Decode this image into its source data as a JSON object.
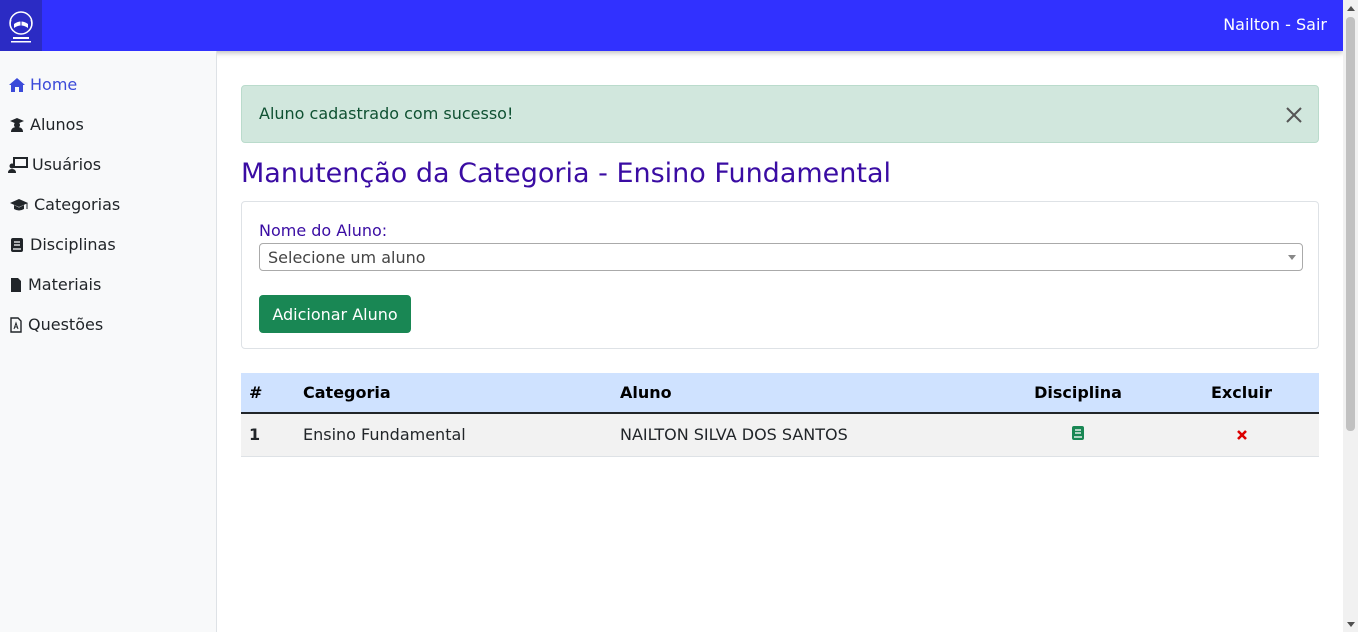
{
  "header": {
    "user_link": "Nailton - Sair",
    "brand_color": "#3131ff"
  },
  "sidebar": {
    "items": [
      {
        "label": "Home",
        "icon": "home-icon",
        "active": true
      },
      {
        "label": "Alunos",
        "icon": "student-icon"
      },
      {
        "label": "Usuários",
        "icon": "chalkboard-user-icon"
      },
      {
        "label": "Categorias",
        "icon": "graduation-cap-icon"
      },
      {
        "label": "Disciplinas",
        "icon": "book-icon"
      },
      {
        "label": "Materiais",
        "icon": "file-icon"
      },
      {
        "label": "Questões",
        "icon": "file-pdf-icon"
      }
    ]
  },
  "alert": {
    "message": "Aluno cadastrado com sucesso!",
    "type": "success"
  },
  "page": {
    "title": "Manutenção da Categoria - Ensino Fundamental"
  },
  "form": {
    "label": "Nome do Aluno:",
    "select_value": "Selecione um aluno",
    "add_button": "Adicionar Aluno"
  },
  "table": {
    "headers": {
      "num": "#",
      "categoria": "Categoria",
      "aluno": "Aluno",
      "disciplina": "Disciplina",
      "excluir": "Excluir"
    },
    "rows": [
      {
        "num": "1",
        "categoria": "Ensino Fundamental",
        "aluno": "NAILTON SILVA DOS SANTOS"
      }
    ]
  },
  "colors": {
    "title": "#3a0ca3",
    "success_button": "#198754",
    "delete_icon": "#dc0000",
    "book_icon": "#198754"
  }
}
